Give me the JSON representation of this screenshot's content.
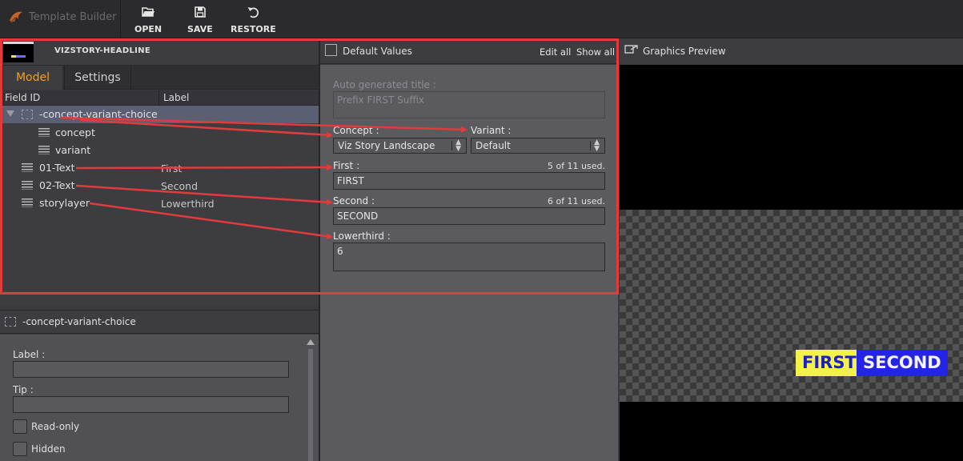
{
  "app": {
    "title": "Template Builder"
  },
  "toolbar": {
    "open_label": "OPEN",
    "save_label": "SAVE",
    "restore_label": "RESTORE"
  },
  "template": {
    "name": "VIZSTORY-HEADLINE"
  },
  "tabs": [
    {
      "label": "Model",
      "active": true
    },
    {
      "label": "Settings",
      "active": false
    }
  ],
  "tree": {
    "columns": [
      "Field ID",
      "Label"
    ],
    "rows": [
      {
        "field_id": "-concept-variant-choice",
        "label": "",
        "type": "group",
        "selected": true
      },
      {
        "field_id": "concept",
        "label": "",
        "type": "field"
      },
      {
        "field_id": "variant",
        "label": "",
        "type": "field"
      },
      {
        "field_id": "01-Text",
        "label": "First",
        "type": "field"
      },
      {
        "field_id": "02-Text",
        "label": "Second",
        "type": "field"
      },
      {
        "field_id": "storylayer",
        "label": "Lowerthird",
        "type": "field"
      }
    ]
  },
  "properties": {
    "title": "-concept-variant-choice",
    "label_caption": "Label :",
    "label_value": "",
    "tip_caption": "Tip :",
    "tip_value": "",
    "readonly_label": "Read-only",
    "hidden_label": "Hidden"
  },
  "defaults": {
    "title": "Default Values",
    "edit_all": "Edit all",
    "show_all": "Show all",
    "auto_title_label": "Auto generated title :",
    "auto_title_value": "Prefix FIRST Suffix",
    "concept_label": "Concept :",
    "concept_value": "Viz Story Landscape",
    "variant_label": "Variant :",
    "variant_value": "Default",
    "first_label": "First :",
    "first_count": "5 of 11 used.",
    "first_value": "FIRST",
    "second_label": "Second :",
    "second_count": "6 of 11 used.",
    "second_value": "SECOND",
    "lowerthird_label": "Lowerthird :",
    "lowerthird_value": "6"
  },
  "preview": {
    "title": "Graphics Preview",
    "first_text": "FIRST",
    "second_text": "SECOND"
  },
  "colors": {
    "accent": "#f0a020",
    "annotation": "#e23b3b",
    "selection": "#5a5f74",
    "gfx_yellow": "#f2f248",
    "gfx_blue": "#2424e6"
  }
}
